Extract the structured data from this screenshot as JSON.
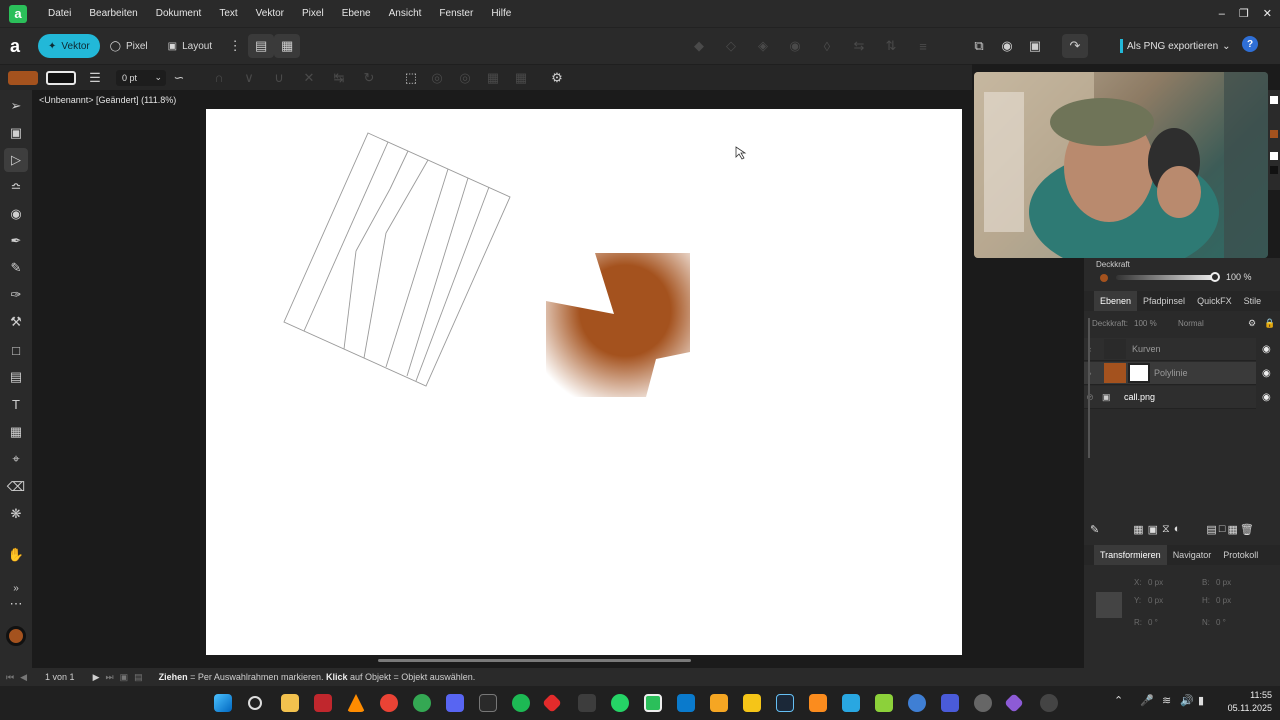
{
  "menubar": {
    "items": [
      "Datei",
      "Bearbeiten",
      "Dokument",
      "Text",
      "Vektor",
      "Pixel",
      "Ebene",
      "Ansicht",
      "Fenster",
      "Hilfe"
    ]
  },
  "toolbar": {
    "personas": [
      "Vektor",
      "Pixel",
      "Layout"
    ],
    "export_label": "Als PNG exportieren"
  },
  "contextbar": {
    "stroke_width": "0 pt",
    "fill_color": "#a4521e"
  },
  "document": {
    "title": "<Unbenannt> [Geändert] (111.8%)"
  },
  "panel": {
    "opacity_label": "Deckkraft",
    "opacity_value": "100 %",
    "tabs": [
      "Ebenen",
      "Pfadpinsel",
      "QuickFX",
      "Stile"
    ],
    "layer_opacity_label": "Deckkraft:",
    "layer_opacity_value": "100 %",
    "blend_mode": "Normal",
    "layers": [
      "Kurven",
      "Polylinie",
      "call.png"
    ]
  },
  "transform": {
    "tabs": [
      "Transformieren",
      "Navigator",
      "Protokoll"
    ],
    "x_label": "X:",
    "x_value": "0 px",
    "y_label": "Y:",
    "y_value": "0 px",
    "b_label": "B:",
    "b_value": "0 px",
    "h_label": "H:",
    "h_value": "0 px",
    "r_label": "R:",
    "r_value": "0 °",
    "n_label": "N:",
    "n_value": "0 °"
  },
  "status": {
    "page": "1 von 1",
    "hint_bold1": "Ziehen",
    "hint_text1": " = Per Auswahlrahmen markieren. ",
    "hint_bold2": "Klick",
    "hint_text2": " auf Objekt = Objekt auswählen."
  },
  "clock": {
    "time": "11:55",
    "date": "05.11.2025"
  },
  "colors": {
    "accent": "#22b8d8",
    "brown": "#a4521e"
  },
  "icons": [
    "select-icon",
    "node-icon",
    "pen-icon",
    "pencil-icon",
    "brush-icon",
    "rect-icon",
    "hand-icon",
    "gear-icon",
    "help-icon",
    "eye-icon",
    "wifi-icon",
    "speaker-icon"
  ]
}
